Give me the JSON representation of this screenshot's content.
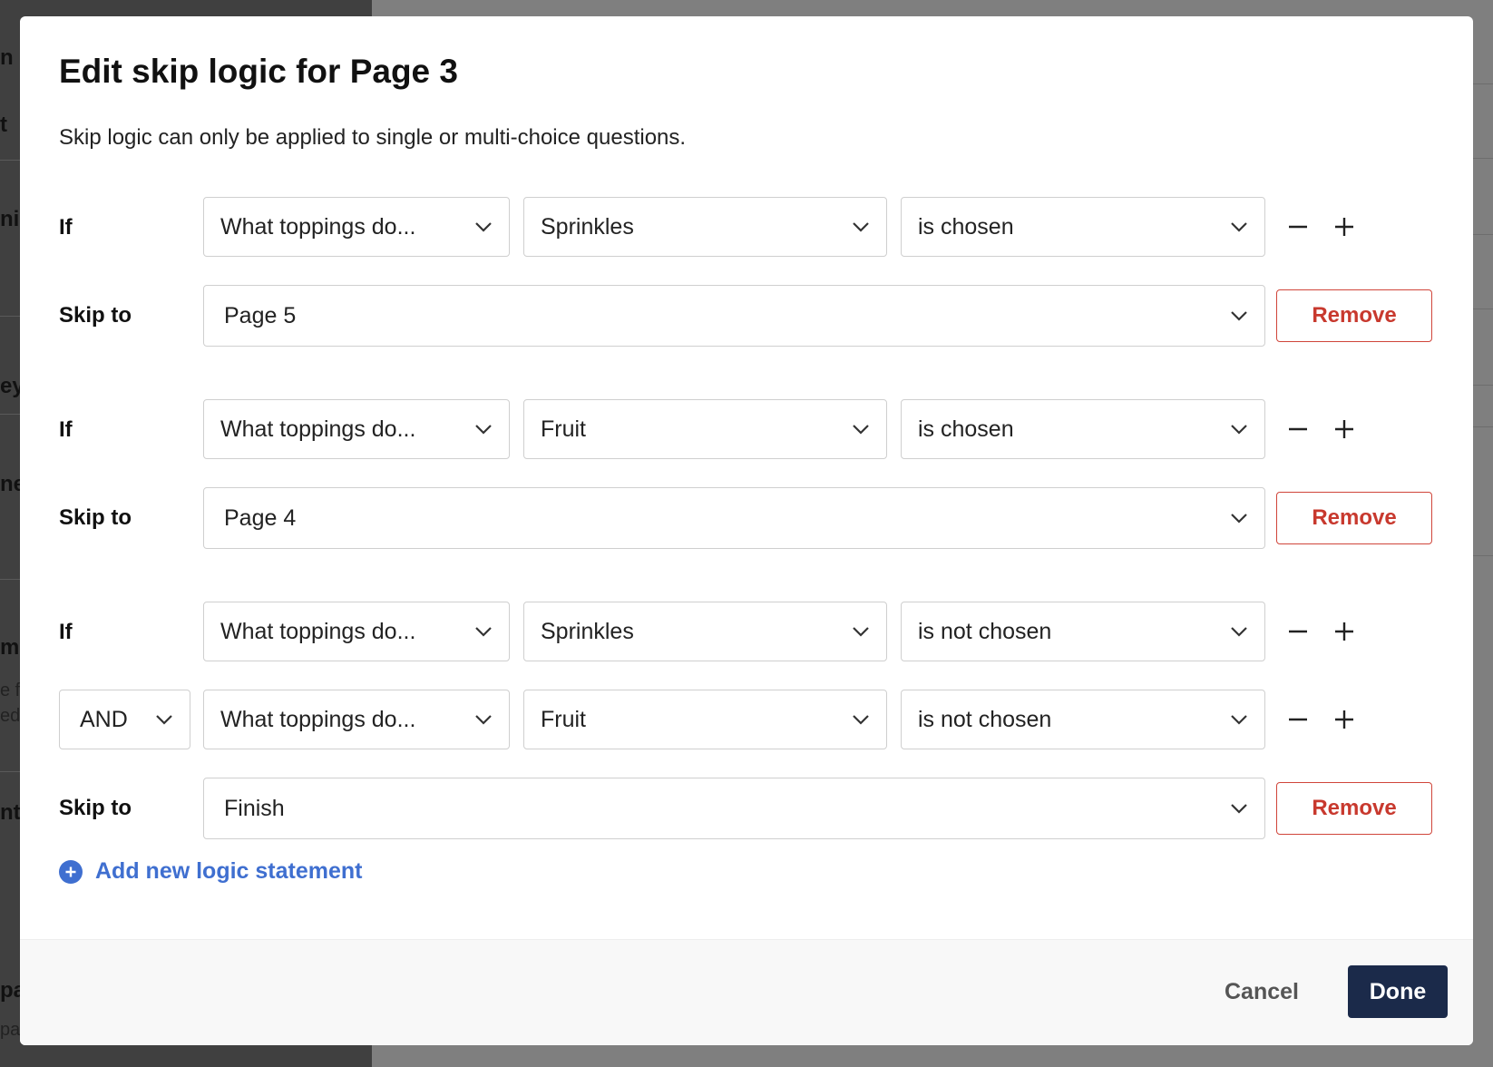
{
  "background": {
    "fragments": [
      "n",
      "t",
      "ni",
      "ey",
      "ne",
      "me",
      "e f",
      "ed",
      "nt",
      "pa",
      "par"
    ]
  },
  "modal": {
    "title": "Edit skip logic for Page 3",
    "description": "Skip logic can only be applied to single or multi-choice questions.",
    "labels": {
      "if": "If",
      "skip_to": "Skip to",
      "and": "AND"
    },
    "remove_label": "Remove",
    "statements": [
      {
        "conditions": [
          {
            "question": "What toppings do...",
            "answer": "Sprinkles",
            "operator": "is chosen"
          }
        ],
        "skip_to": "Page 5"
      },
      {
        "conditions": [
          {
            "question": "What toppings do...",
            "answer": "Fruit",
            "operator": "is chosen"
          }
        ],
        "skip_to": "Page 4"
      },
      {
        "conditions": [
          {
            "question": "What toppings do...",
            "answer": "Sprinkles",
            "operator": "is not chosen"
          },
          {
            "question": "What toppings do...",
            "answer": "Fruit",
            "operator": "is not chosen"
          }
        ],
        "skip_to": "Finish"
      }
    ],
    "add_statement_label": "Add new logic statement",
    "footer": {
      "cancel_label": "Cancel",
      "done_label": "Done"
    }
  },
  "colors": {
    "remove": "#c8392e",
    "link": "#3f6fd0",
    "primary": "#1b2a4a"
  },
  "icons": [
    "chevron-down-icon",
    "minus-icon",
    "plus-icon",
    "plus-circle-icon"
  ]
}
